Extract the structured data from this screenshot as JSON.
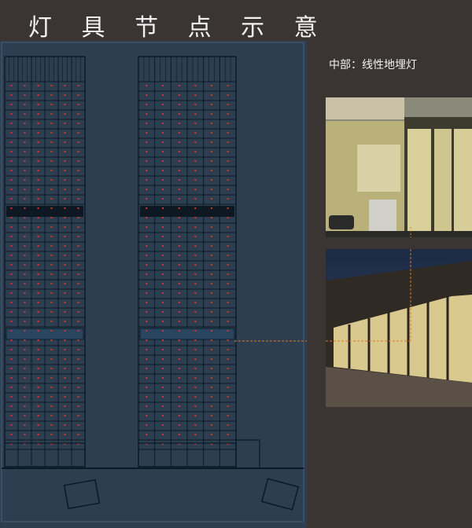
{
  "page": {
    "title": "灯 具 节 点 示 意",
    "section_label": "中部：线性地埋灯"
  },
  "colors": {
    "background": "#3a3533",
    "drawing_background": "#2c3e50",
    "line_color": "#0b1a26",
    "light_marker": "#e0302a",
    "leader_line": "#e07a2a",
    "warm_light": "#e9d9a6"
  },
  "icons": {
    "marker": "red-dot-light-marker",
    "leader": "orange-dashed-leader-line"
  }
}
